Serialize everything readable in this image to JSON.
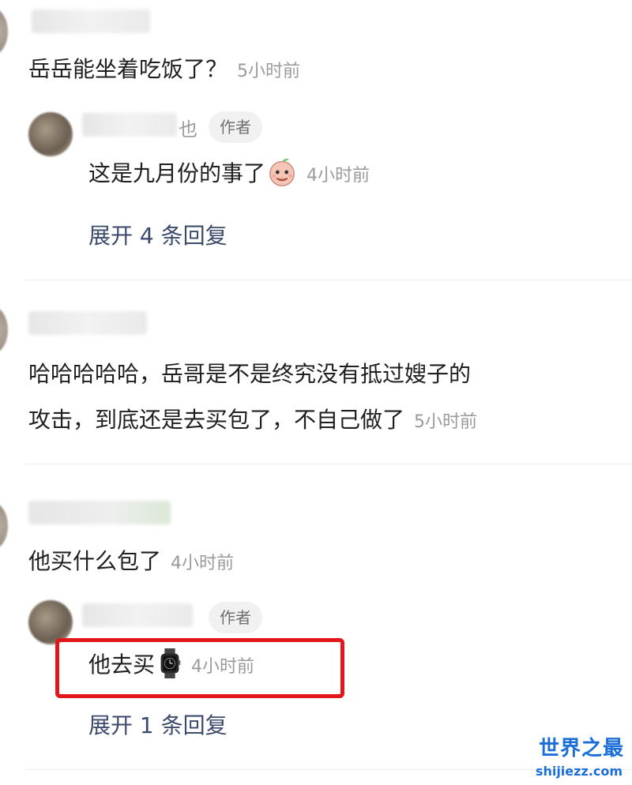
{
  "comments": [
    {
      "text": "岳岳能坐着吃饭了？",
      "time": "5小时前",
      "reply": {
        "author_suffix": "也",
        "badge": "作者",
        "text": "这是九月份的事了",
        "emoji": "peach-face-emoji",
        "time": "4小时前",
        "expand": "展开 4 条回复"
      }
    },
    {
      "text_line1": "哈哈哈哈哈，岳哥是不是终究没有抵过嫂子的",
      "text_line2": "攻击，到底还是去买包了，不自己做了",
      "time": "5小时前"
    },
    {
      "text": "他买什么包了",
      "time": "4小时前",
      "reply": {
        "badge": "作者",
        "text": "他去买",
        "emoji": "watch-emoji",
        "time": "4小时前",
        "expand": "展开 1 条回复"
      }
    }
  ],
  "highlight_color": "#e1171c",
  "watermark": {
    "title": "世界之最",
    "url": "shijiezz.com"
  }
}
